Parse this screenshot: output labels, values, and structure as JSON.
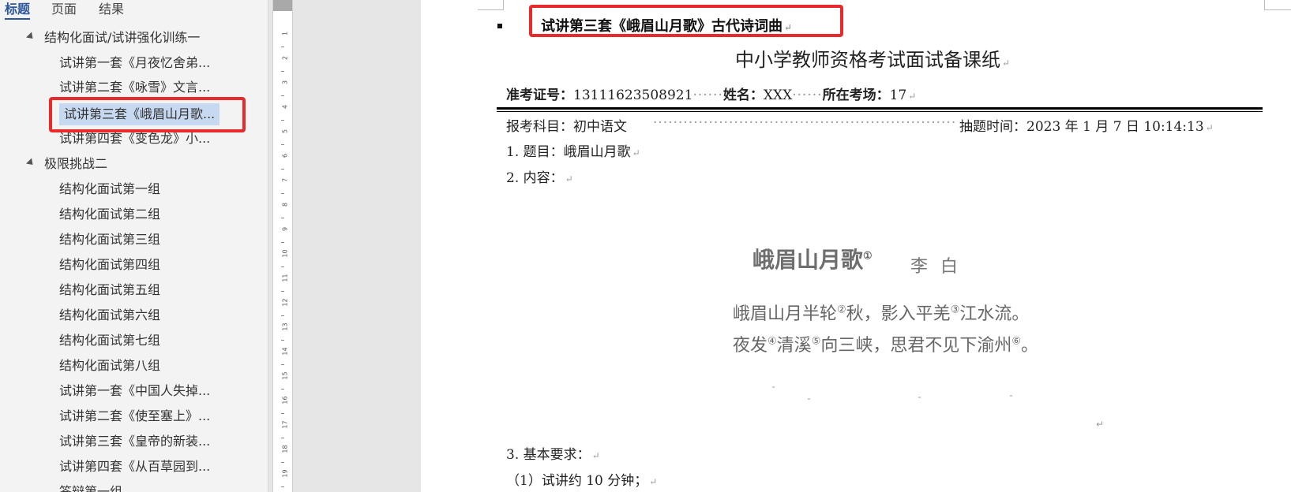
{
  "nav": {
    "tabs": [
      "标题",
      "页面",
      "结果"
    ],
    "groups": [
      {
        "label": "结构化面试/试讲强化训练一"
      },
      {
        "label": "极限挑战二"
      }
    ],
    "items_group1": [
      "试讲第一套《月夜忆舍弟...",
      "试讲第二套《咏雪》文言...",
      "试讲第三套《峨眉山月歌...",
      "试讲第四套《变色龙》小..."
    ],
    "items_group2": [
      "结构化面试第一组",
      "结构化面试第二组",
      "结构化面试第三组",
      "结构化面试第四组",
      "结构化面试第五组",
      "结构化面试第六组",
      "结构化面试第七组",
      "结构化面试第八组",
      "试讲第一套《中国人失掉...",
      "试讲第二套《使至塞上》...",
      "试讲第三套《皇帝的新装...",
      "试讲第四套《从百草园到...",
      "答辩第一组"
    ]
  },
  "ruler": {
    "ticks": [
      "1",
      "2",
      "3",
      "4",
      "5",
      "6",
      "7",
      "8",
      "9",
      "10",
      "11",
      "12",
      "13",
      "14",
      "15",
      "16",
      "17",
      "18",
      "19"
    ]
  },
  "doc": {
    "heading": "试讲第三套《峨眉山月歌》古代诗词曲",
    "title": "中小学教师资格考试面试备课纸",
    "exam_id_label": "准考证号：",
    "exam_id_value": "13111623508921",
    "name_label": "姓名：",
    "name_value": "XXX",
    "room_label": "所在考场：",
    "room_value": "17",
    "subject": "报考科目：初中语文",
    "draw_time": "抽题时间：2023 年 1 月 7 日 10:14:13",
    "topic": "1. 题目：峨眉山月歌",
    "content_label": "2. 内容：",
    "requirements_label": "3. 基本要求：",
    "requirement_1": "（1）试讲约 10 分钟；",
    "poem": {
      "title": "峨眉山月歌",
      "title_note": "①",
      "author": "李白",
      "line1_a": "峨眉山月半轮",
      "line1_n1": "②",
      "line1_b": "秋，影入平羌",
      "line1_n2": "③",
      "line1_c": "江水流。",
      "line2_a": "夜发",
      "line2_n1": "④",
      "line2_b": "清溪",
      "line2_n2": "⑤",
      "line2_c": "向三峡，思君不见下渝州",
      "line2_n3": "⑥",
      "line2_d": "。"
    }
  }
}
